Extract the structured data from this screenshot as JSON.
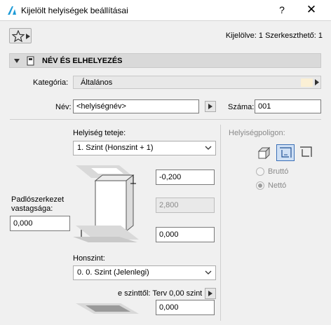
{
  "window": {
    "title": "Kijelölt helyiségek beállításai",
    "help": "?",
    "close": "✕"
  },
  "summary": "Kijelölve: 1 Szerkeszthető: 1",
  "section": {
    "title": "NÉV ÉS ELHELYEZÉS"
  },
  "kategoria": {
    "label": "Kategória:",
    "value": "Általános",
    "swatch_color": "#fbf0d5"
  },
  "nev": {
    "label": "Név:",
    "value": "<helyiségnév>"
  },
  "szama": {
    "label": "Száma:",
    "value": "001"
  },
  "teteje": {
    "label": "Helyiség teteje:",
    "value": "1. Szint (Honszint + 1)"
  },
  "values": {
    "top_offset": "-0,200",
    "height": "2,800",
    "bottom_offset": "0,000",
    "padlo": "0,000",
    "szinttol": "0,000"
  },
  "padlo": {
    "label_line1": "Padlószerkezet",
    "label_line2": "vastagsága:"
  },
  "honszint": {
    "label": "Honszint:",
    "value": "0. 0. Szint (Jelenlegi)"
  },
  "szinttol": {
    "label": "e szinttől: Terv 0,00 szint"
  },
  "polygon": {
    "label": "Helyiségpoligon:",
    "brutto": "Bruttó",
    "netto": "Nettó",
    "selected": "Nettó"
  },
  "colors": {
    "accent": "#3b6fb6",
    "icon_blue": "#1e9bd7"
  }
}
